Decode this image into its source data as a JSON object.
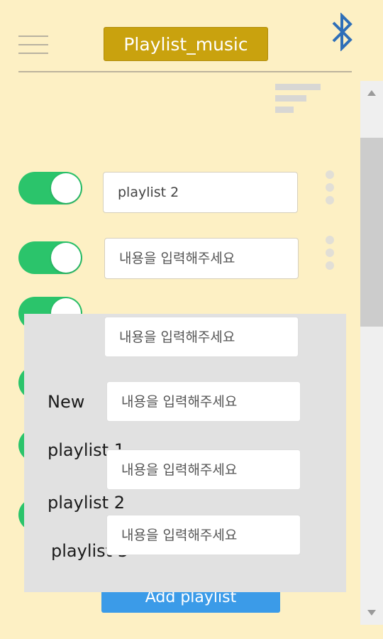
{
  "header": {
    "title": "Playlist_music",
    "title_bg": "#c9a20e",
    "menu_icon": "hamburger-icon",
    "bluetooth_icon": "bluetooth-icon",
    "bluetooth_color": "#2f6fb8"
  },
  "sort_icon": "sort-icon",
  "rows": [
    {
      "value": "playlist 2",
      "placeholder": "내용을 입력해주세요",
      "toggle_on": true
    },
    {
      "value": "",
      "placeholder": "내용을 입력해주세요",
      "toggle_on": true
    },
    {
      "value": "",
      "placeholder": "",
      "toggle_on": true
    },
    {
      "value": "",
      "placeholder": "",
      "toggle_on": true
    },
    {
      "value": "",
      "placeholder": "",
      "toggle_on": true
    },
    {
      "value": "",
      "placeholder": "",
      "toggle_on": true
    }
  ],
  "add_button": {
    "label": "Add playlist",
    "color": "#3b9be8"
  },
  "overlay": {
    "names": [
      "New",
      "playlist 1",
      "playlist 2",
      "playlist 3"
    ],
    "inputs": [
      {
        "placeholder": "내용을 입력해주세요"
      },
      {
        "placeholder": "내용을 입력해주세요"
      },
      {
        "placeholder": "내용을 입력해주세요"
      },
      {
        "placeholder": "내용을 입력해주세요"
      }
    ]
  },
  "accent_toggle": "#2bc46b"
}
